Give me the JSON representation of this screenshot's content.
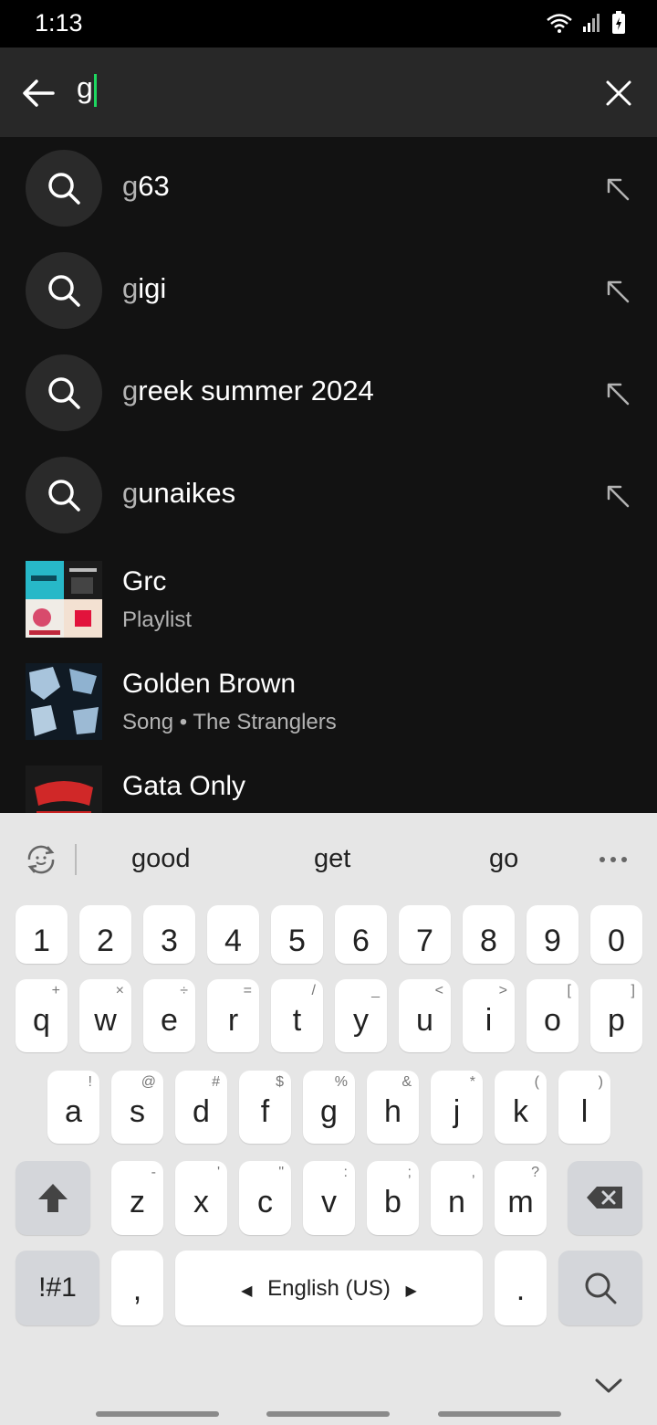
{
  "status": {
    "time": "1:13"
  },
  "search": {
    "query": "g"
  },
  "suggestions": [
    {
      "prefix": "g",
      "rest": "63"
    },
    {
      "prefix": "g",
      "rest": "igi"
    },
    {
      "prefix": "g",
      "rest": "reek summer 2024"
    },
    {
      "prefix": "g",
      "rest": "unaikes"
    }
  ],
  "results": [
    {
      "title": "Grc",
      "subtitle": "Playlist"
    },
    {
      "title": "Golden Brown",
      "subtitle": "Song • The Stranglers"
    },
    {
      "title": "Gata Only",
      "subtitle": ""
    }
  ],
  "keyboard": {
    "predictions": [
      "good",
      "get",
      "go"
    ],
    "number_row": [
      "1",
      "2",
      "3",
      "4",
      "5",
      "6",
      "7",
      "8",
      "9",
      "0"
    ],
    "row1": [
      {
        "k": "q",
        "a": "+"
      },
      {
        "k": "w",
        "a": "×"
      },
      {
        "k": "e",
        "a": "÷"
      },
      {
        "k": "r",
        "a": "="
      },
      {
        "k": "t",
        "a": "/"
      },
      {
        "k": "y",
        "a": "_"
      },
      {
        "k": "u",
        "a": "<"
      },
      {
        "k": "i",
        "a": ">"
      },
      {
        "k": "o",
        "a": "["
      },
      {
        "k": "p",
        "a": "]"
      }
    ],
    "row2": [
      {
        "k": "a",
        "a": "!"
      },
      {
        "k": "s",
        "a": "@"
      },
      {
        "k": "d",
        "a": "#"
      },
      {
        "k": "f",
        "a": "$"
      },
      {
        "k": "g",
        "a": "%"
      },
      {
        "k": "h",
        "a": "&"
      },
      {
        "k": "j",
        "a": "*"
      },
      {
        "k": "k",
        "a": "("
      },
      {
        "k": "l",
        "a": ")"
      }
    ],
    "row3": [
      {
        "k": "z",
        "a": "-"
      },
      {
        "k": "x",
        "a": "'"
      },
      {
        "k": "c",
        "a": "\""
      },
      {
        "k": "v",
        "a": ":"
      },
      {
        "k": "b",
        "a": ";"
      },
      {
        "k": "n",
        "a": ","
      },
      {
        "k": "m",
        "a": "?"
      }
    ],
    "symbols_label": "!#1",
    "comma_label": ",",
    "space_label": "English (US)",
    "period_label": "."
  }
}
